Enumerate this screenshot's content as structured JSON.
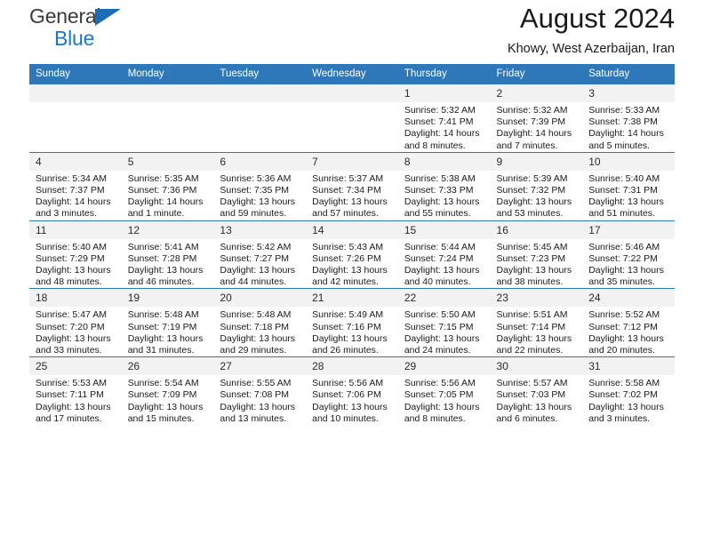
{
  "brand": {
    "name_top": "General",
    "name_bottom": "Blue",
    "flag_icon": "triangle-flag-icon",
    "accent_color": "#1b78c7"
  },
  "header": {
    "title": "August 2024",
    "subtitle": "Khowy, West Azerbaijan, Iran"
  },
  "theme": {
    "header_blue": "#2e77b8",
    "daynum_background": "#f2f2f2",
    "text_color": "#1a1a1a"
  },
  "weekdays": [
    "Sunday",
    "Monday",
    "Tuesday",
    "Wednesday",
    "Thursday",
    "Friday",
    "Saturday"
  ],
  "weeks": [
    [
      {
        "day": "",
        "blank": true,
        "sunrise": "",
        "sunset": "",
        "daylight_line1": "",
        "daylight_line2": ""
      },
      {
        "day": "",
        "blank": true,
        "sunrise": "",
        "sunset": "",
        "daylight_line1": "",
        "daylight_line2": ""
      },
      {
        "day": "",
        "blank": true,
        "sunrise": "",
        "sunset": "",
        "daylight_line1": "",
        "daylight_line2": ""
      },
      {
        "day": "",
        "blank": true,
        "sunrise": "",
        "sunset": "",
        "daylight_line1": "",
        "daylight_line2": ""
      },
      {
        "day": "1",
        "sunrise": "Sunrise: 5:32 AM",
        "sunset": "Sunset: 7:41 PM",
        "daylight_line1": "Daylight: 14 hours",
        "daylight_line2": "and 8 minutes."
      },
      {
        "day": "2",
        "sunrise": "Sunrise: 5:32 AM",
        "sunset": "Sunset: 7:39 PM",
        "daylight_line1": "Daylight: 14 hours",
        "daylight_line2": "and 7 minutes."
      },
      {
        "day": "3",
        "sunrise": "Sunrise: 5:33 AM",
        "sunset": "Sunset: 7:38 PM",
        "daylight_line1": "Daylight: 14 hours",
        "daylight_line2": "and 5 minutes."
      }
    ],
    [
      {
        "day": "4",
        "sunrise": "Sunrise: 5:34 AM",
        "sunset": "Sunset: 7:37 PM",
        "daylight_line1": "Daylight: 14 hours",
        "daylight_line2": "and 3 minutes."
      },
      {
        "day": "5",
        "sunrise": "Sunrise: 5:35 AM",
        "sunset": "Sunset: 7:36 PM",
        "daylight_line1": "Daylight: 14 hours",
        "daylight_line2": "and 1 minute."
      },
      {
        "day": "6",
        "sunrise": "Sunrise: 5:36 AM",
        "sunset": "Sunset: 7:35 PM",
        "daylight_line1": "Daylight: 13 hours",
        "daylight_line2": "and 59 minutes."
      },
      {
        "day": "7",
        "sunrise": "Sunrise: 5:37 AM",
        "sunset": "Sunset: 7:34 PM",
        "daylight_line1": "Daylight: 13 hours",
        "daylight_line2": "and 57 minutes."
      },
      {
        "day": "8",
        "sunrise": "Sunrise: 5:38 AM",
        "sunset": "Sunset: 7:33 PM",
        "daylight_line1": "Daylight: 13 hours",
        "daylight_line2": "and 55 minutes."
      },
      {
        "day": "9",
        "sunrise": "Sunrise: 5:39 AM",
        "sunset": "Sunset: 7:32 PM",
        "daylight_line1": "Daylight: 13 hours",
        "daylight_line2": "and 53 minutes."
      },
      {
        "day": "10",
        "sunrise": "Sunrise: 5:40 AM",
        "sunset": "Sunset: 7:31 PM",
        "daylight_line1": "Daylight: 13 hours",
        "daylight_line2": "and 51 minutes."
      }
    ],
    [
      {
        "day": "11",
        "sunrise": "Sunrise: 5:40 AM",
        "sunset": "Sunset: 7:29 PM",
        "daylight_line1": "Daylight: 13 hours",
        "daylight_line2": "and 48 minutes."
      },
      {
        "day": "12",
        "sunrise": "Sunrise: 5:41 AM",
        "sunset": "Sunset: 7:28 PM",
        "daylight_line1": "Daylight: 13 hours",
        "daylight_line2": "and 46 minutes."
      },
      {
        "day": "13",
        "sunrise": "Sunrise: 5:42 AM",
        "sunset": "Sunset: 7:27 PM",
        "daylight_line1": "Daylight: 13 hours",
        "daylight_line2": "and 44 minutes."
      },
      {
        "day": "14",
        "sunrise": "Sunrise: 5:43 AM",
        "sunset": "Sunset: 7:26 PM",
        "daylight_line1": "Daylight: 13 hours",
        "daylight_line2": "and 42 minutes."
      },
      {
        "day": "15",
        "sunrise": "Sunrise: 5:44 AM",
        "sunset": "Sunset: 7:24 PM",
        "daylight_line1": "Daylight: 13 hours",
        "daylight_line2": "and 40 minutes."
      },
      {
        "day": "16",
        "sunrise": "Sunrise: 5:45 AM",
        "sunset": "Sunset: 7:23 PM",
        "daylight_line1": "Daylight: 13 hours",
        "daylight_line2": "and 38 minutes."
      },
      {
        "day": "17",
        "sunrise": "Sunrise: 5:46 AM",
        "sunset": "Sunset: 7:22 PM",
        "daylight_line1": "Daylight: 13 hours",
        "daylight_line2": "and 35 minutes."
      }
    ],
    [
      {
        "day": "18",
        "sunrise": "Sunrise: 5:47 AM",
        "sunset": "Sunset: 7:20 PM",
        "daylight_line1": "Daylight: 13 hours",
        "daylight_line2": "and 33 minutes."
      },
      {
        "day": "19",
        "sunrise": "Sunrise: 5:48 AM",
        "sunset": "Sunset: 7:19 PM",
        "daylight_line1": "Daylight: 13 hours",
        "daylight_line2": "and 31 minutes."
      },
      {
        "day": "20",
        "sunrise": "Sunrise: 5:48 AM",
        "sunset": "Sunset: 7:18 PM",
        "daylight_line1": "Daylight: 13 hours",
        "daylight_line2": "and 29 minutes."
      },
      {
        "day": "21",
        "sunrise": "Sunrise: 5:49 AM",
        "sunset": "Sunset: 7:16 PM",
        "daylight_line1": "Daylight: 13 hours",
        "daylight_line2": "and 26 minutes."
      },
      {
        "day": "22",
        "sunrise": "Sunrise: 5:50 AM",
        "sunset": "Sunset: 7:15 PM",
        "daylight_line1": "Daylight: 13 hours",
        "daylight_line2": "and 24 minutes."
      },
      {
        "day": "23",
        "sunrise": "Sunrise: 5:51 AM",
        "sunset": "Sunset: 7:14 PM",
        "daylight_line1": "Daylight: 13 hours",
        "daylight_line2": "and 22 minutes."
      },
      {
        "day": "24",
        "sunrise": "Sunrise: 5:52 AM",
        "sunset": "Sunset: 7:12 PM",
        "daylight_line1": "Daylight: 13 hours",
        "daylight_line2": "and 20 minutes."
      }
    ],
    [
      {
        "day": "25",
        "sunrise": "Sunrise: 5:53 AM",
        "sunset": "Sunset: 7:11 PM",
        "daylight_line1": "Daylight: 13 hours",
        "daylight_line2": "and 17 minutes."
      },
      {
        "day": "26",
        "sunrise": "Sunrise: 5:54 AM",
        "sunset": "Sunset: 7:09 PM",
        "daylight_line1": "Daylight: 13 hours",
        "daylight_line2": "and 15 minutes."
      },
      {
        "day": "27",
        "sunrise": "Sunrise: 5:55 AM",
        "sunset": "Sunset: 7:08 PM",
        "daylight_line1": "Daylight: 13 hours",
        "daylight_line2": "and 13 minutes."
      },
      {
        "day": "28",
        "sunrise": "Sunrise: 5:56 AM",
        "sunset": "Sunset: 7:06 PM",
        "daylight_line1": "Daylight: 13 hours",
        "daylight_line2": "and 10 minutes."
      },
      {
        "day": "29",
        "sunrise": "Sunrise: 5:56 AM",
        "sunset": "Sunset: 7:05 PM",
        "daylight_line1": "Daylight: 13 hours",
        "daylight_line2": "and 8 minutes."
      },
      {
        "day": "30",
        "sunrise": "Sunrise: 5:57 AM",
        "sunset": "Sunset: 7:03 PM",
        "daylight_line1": "Daylight: 13 hours",
        "daylight_line2": "and 6 minutes."
      },
      {
        "day": "31",
        "sunrise": "Sunrise: 5:58 AM",
        "sunset": "Sunset: 7:02 PM",
        "daylight_line1": "Daylight: 13 hours",
        "daylight_line2": "and 3 minutes."
      }
    ]
  ]
}
